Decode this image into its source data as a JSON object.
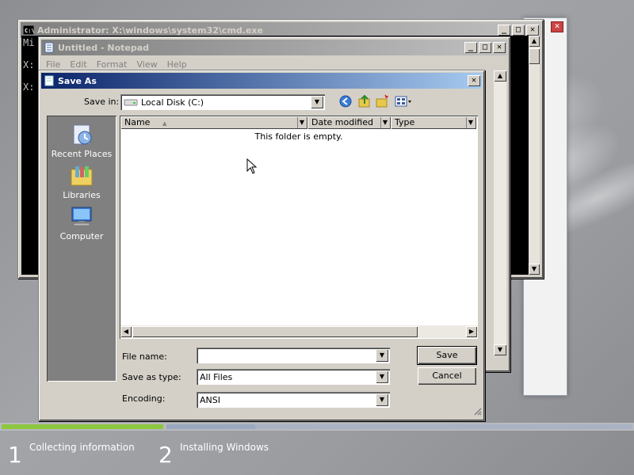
{
  "cmd_window": {
    "title": "Administrator: X:\\windows\\system32\\cmd.exe",
    "lines": [
      "Mi",
      "",
      "X:",
      "",
      "X:"
    ]
  },
  "notepad_window": {
    "title": "Untitled - Notepad",
    "menu": [
      "File",
      "Edit",
      "Format",
      "View",
      "Help"
    ]
  },
  "save_as": {
    "title": "Save As",
    "save_in_label": "Save in:",
    "save_in_value": "Local Disk (C:)",
    "places": [
      {
        "label": "Recent Places",
        "icon": "recent-places-icon"
      },
      {
        "label": "Libraries",
        "icon": "libraries-icon"
      },
      {
        "label": "Computer",
        "icon": "computer-icon"
      }
    ],
    "columns": [
      "Name",
      "Date modified",
      "Type"
    ],
    "empty_text": "This folder is empty.",
    "file_name_label": "File name:",
    "file_name_value": "",
    "save_as_type_label": "Save as type:",
    "save_as_type_value": "All Files",
    "encoding_label": "Encoding:",
    "encoding_value": "ANSI",
    "save_button": "Save",
    "cancel_button": "Cancel"
  },
  "setup_steps": [
    {
      "number": "1",
      "label": "Collecting information"
    },
    {
      "number": "2",
      "label": "Installing Windows"
    }
  ],
  "colors": {
    "progress_done": "#8dc63f",
    "progress_pending": "#9aa8c0",
    "title_active": "#0a246a"
  }
}
